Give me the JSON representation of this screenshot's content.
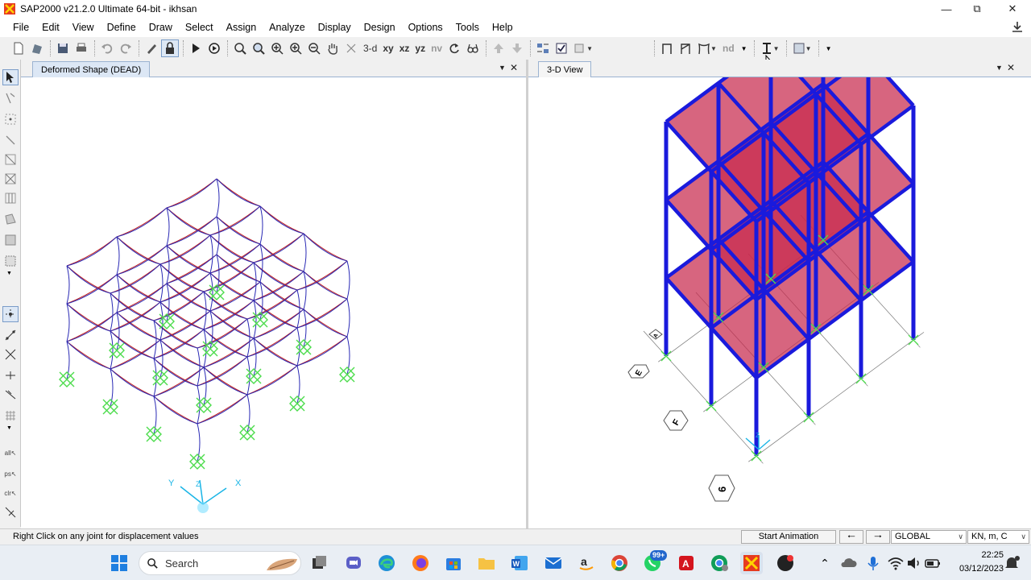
{
  "window": {
    "title": "SAP2000 v21.2.0 Ultimate 64-bit - ikhsan"
  },
  "menu": [
    "File",
    "Edit",
    "View",
    "Define",
    "Draw",
    "Select",
    "Assign",
    "Analyze",
    "Display",
    "Design",
    "Options",
    "Tools",
    "Help"
  ],
  "toolbar": {
    "view_3d": "3-d",
    "view_xy": "xy",
    "view_xz": "xz",
    "view_yz": "yz",
    "view_nv": "nv",
    "nd": "nd"
  },
  "panels": {
    "left": {
      "tab": "Deformed Shape (DEAD)"
    },
    "right": {
      "tab": "3-D View"
    }
  },
  "grid_labels": {
    "bubble_a": "A",
    "bubble_e": "E",
    "bubble_f": "F",
    "bubble_6": "6"
  },
  "axes": {
    "x": "X",
    "y": "Y",
    "z": "Z"
  },
  "status": {
    "message": "Right Click on any joint for displacement values",
    "animation_button": "Start Animation",
    "coord_system": "GLOBAL",
    "units": "KN, m, C"
  },
  "taskbar": {
    "search_placeholder": "Search",
    "whatsapp_badge": "99+",
    "time": "22:25",
    "date": "03/12/2023"
  },
  "colors": {
    "frame_blue": "#1a1adc",
    "slab_red": "#c8294d",
    "deformed_red": "#c01d1d",
    "deformed_blue": "#2a2ab5",
    "support_green": "#4ddc4d",
    "tab_active_bg": "#dce7f5"
  }
}
